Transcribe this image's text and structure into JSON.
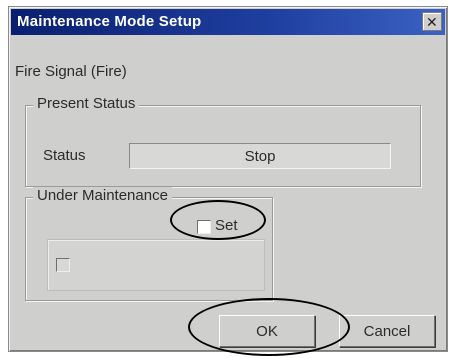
{
  "dialog": {
    "title": "Maintenance Mode Setup",
    "close_glyph": "✕",
    "subtitle": "Fire Signal (Fire)"
  },
  "present_status": {
    "group_label": "Present Status",
    "status_label": "Status",
    "status_value": "Stop"
  },
  "maintenance": {
    "group_label": "Under Maintenance",
    "set_label": "Set",
    "set_checked": false,
    "disabled_option_checked": false
  },
  "buttons": {
    "ok": "OK",
    "cancel": "Cancel"
  },
  "icons": [
    "close-icon"
  ]
}
